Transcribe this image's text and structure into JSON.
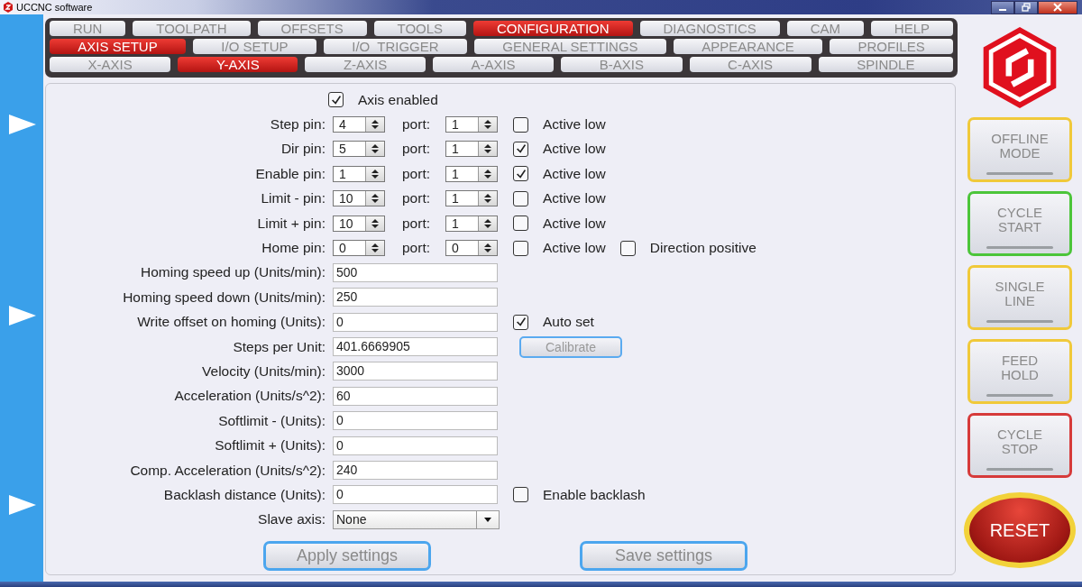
{
  "window": {
    "title": "UCCNC software"
  },
  "tab_rows": [
    [
      {
        "label": "RUN",
        "selected": false
      },
      {
        "label": "TOOLPATH",
        "selected": false
      },
      {
        "label": "OFFSETS",
        "selected": false
      },
      {
        "label": "TOOLS",
        "selected": false
      },
      {
        "label": "CONFIGURATION",
        "selected": true
      },
      {
        "label": "DIAGNOSTICS",
        "selected": false
      },
      {
        "label": "CAM",
        "selected": false
      },
      {
        "label": "HELP",
        "selected": false
      }
    ],
    [
      {
        "label": "AXIS SETUP",
        "selected": true
      },
      {
        "label": "I/O SETUP",
        "selected": false
      },
      {
        "label": "I/O  TRIGGER",
        "selected": false
      },
      {
        "label": "GENERAL SETTINGS",
        "selected": false
      },
      {
        "label": "APPEARANCE",
        "selected": false
      },
      {
        "label": "PROFILES",
        "selected": false
      }
    ],
    [
      {
        "label": "X-AXIS",
        "selected": false
      },
      {
        "label": "Y-AXIS",
        "selected": true
      },
      {
        "label": "Z-AXIS",
        "selected": false
      },
      {
        "label": "A-AXIS",
        "selected": false
      },
      {
        "label": "B-AXIS",
        "selected": false
      },
      {
        "label": "C-AXIS",
        "selected": false
      },
      {
        "label": "SPINDLE",
        "selected": false
      }
    ]
  ],
  "axis_enabled": {
    "label": "Axis enabled",
    "checked": true
  },
  "pin_rows": [
    {
      "label": "Step pin:",
      "pin": "4",
      "port_label": "port:",
      "port": "1",
      "options": [
        {
          "label": "Active low",
          "checked": false
        }
      ]
    },
    {
      "label": "Dir pin:",
      "pin": "5",
      "port_label": "port:",
      "port": "1",
      "options": [
        {
          "label": "Active low",
          "checked": true
        }
      ]
    },
    {
      "label": "Enable pin:",
      "pin": "1",
      "port_label": "port:",
      "port": "1",
      "options": [
        {
          "label": "Active low",
          "checked": true
        }
      ]
    },
    {
      "label": "Limit - pin:",
      "pin": "10",
      "port_label": "port:",
      "port": "1",
      "options": [
        {
          "label": "Active low",
          "checked": false
        }
      ]
    },
    {
      "label": "Limit + pin:",
      "pin": "10",
      "port_label": "port:",
      "port": "1",
      "options": [
        {
          "label": "Active low",
          "checked": false
        }
      ]
    },
    {
      "label": "Home pin:",
      "pin": "0",
      "port_label": "port:",
      "port": "0",
      "options": [
        {
          "label": "Active low",
          "checked": false
        },
        {
          "label": "Direction positive",
          "checked": false
        }
      ]
    }
  ],
  "fields": [
    {
      "kind": "text",
      "label": "Homing speed up (Units/min):",
      "value": "500"
    },
    {
      "kind": "text",
      "label": "Homing speed down (Units/min):",
      "value": "250"
    },
    {
      "kind": "text",
      "label": "Write offset on homing (Units):",
      "value": "0",
      "option": {
        "label": "Auto set",
        "checked": true
      }
    },
    {
      "kind": "text",
      "label": "Steps per Unit:",
      "value": "401.6669905",
      "button": "Calibrate"
    },
    {
      "kind": "text",
      "label": "Velocity (Units/min):",
      "value": "3000"
    },
    {
      "kind": "text",
      "label": "Acceleration (Units/s^2):",
      "value": "60"
    },
    {
      "kind": "text",
      "label": "Softlimit - (Units):",
      "value": "0"
    },
    {
      "kind": "text",
      "label": "Softlimit + (Units):",
      "value": "0"
    },
    {
      "kind": "text",
      "label": "Comp. Acceleration (Units/s^2):",
      "value": "240"
    },
    {
      "kind": "text",
      "label": "Backlash distance (Units):",
      "value": "0",
      "option": {
        "label": "Enable backlash",
        "checked": false
      }
    },
    {
      "kind": "dropdown",
      "label": "Slave axis:",
      "value": "None"
    }
  ],
  "actions": [
    "Apply settings",
    "Save settings"
  ],
  "side_buttons": [
    {
      "label": "OFFLINE MODE",
      "color": "#f0c93a"
    },
    {
      "label": "CYCLE START",
      "color": "#4cc53a"
    },
    {
      "label": "SINGLE LINE",
      "color": "#f0c93a"
    },
    {
      "label": "FEED HOLD",
      "color": "#f0c93a"
    },
    {
      "label": "CYCLE STOP",
      "color": "#d63a3a"
    }
  ],
  "reset_button": "RESET"
}
